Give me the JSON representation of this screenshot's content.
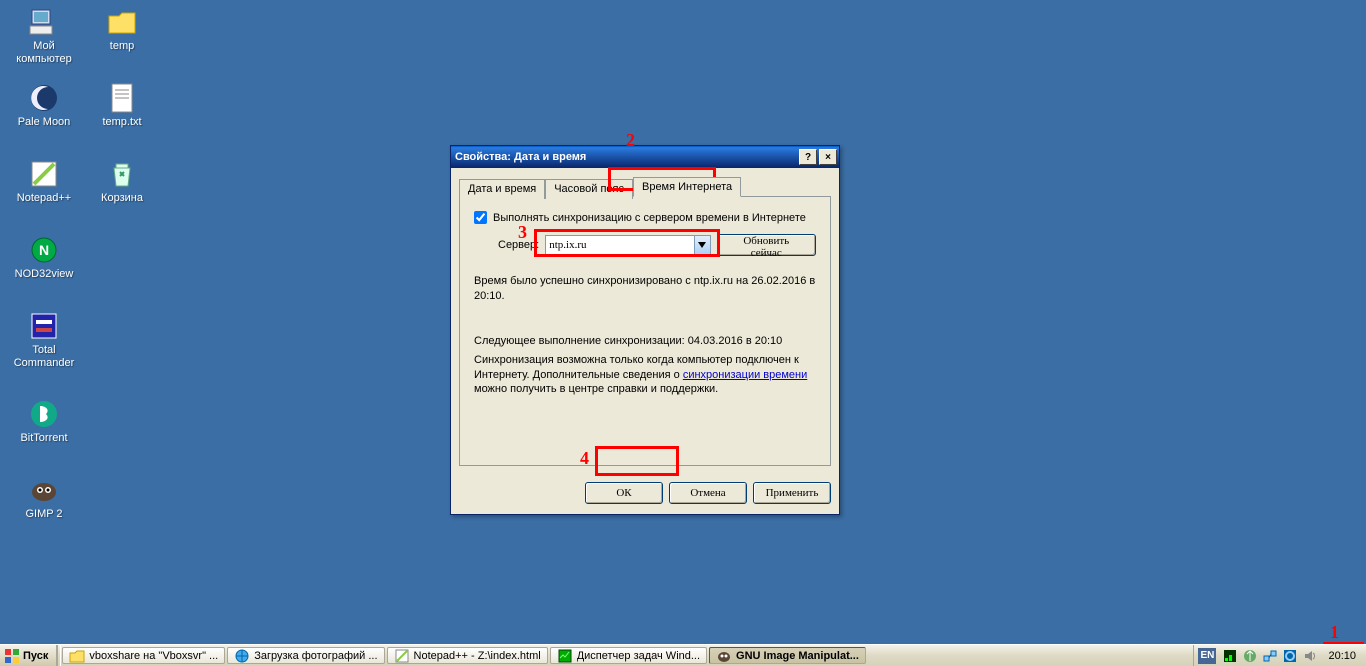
{
  "desktop_icons": [
    {
      "name": "my-computer",
      "label": "Мой\nкомпьютер"
    },
    {
      "name": "temp-folder",
      "label": "temp"
    },
    {
      "name": "pale-moon",
      "label": "Pale Moon"
    },
    {
      "name": "temp-txt",
      "label": "temp.txt"
    },
    {
      "name": "notepadpp",
      "label": "Notepad++"
    },
    {
      "name": "recycle-bin",
      "label": "Корзина"
    },
    {
      "name": "nod32view",
      "label": "NOD32view"
    },
    {
      "name": "total-commander",
      "label": "Total\nCommander"
    },
    {
      "name": "bittorrent",
      "label": "BitTorrent"
    },
    {
      "name": "gimp2",
      "label": "GIMP 2"
    }
  ],
  "dialog": {
    "title": "Свойства: Дата и время",
    "help_label": "?",
    "close_label": "×",
    "tabs": [
      {
        "label": "Дата и время"
      },
      {
        "label": "Часовой пояс"
      },
      {
        "label": "Время Интернета"
      }
    ],
    "active_tab": 2,
    "sync_checkbox_label": "Выполнять синхронизацию с сервером времени в Интернете",
    "sync_checked": true,
    "server_label": "Сервер:",
    "server_value": "ntp.ix.ru",
    "refresh_label": "Обновить сейчас",
    "status_text": "Время было успешно синхронизировано с ntp.ix.ru на 26.02.2016 в 20:10.",
    "next_text": "Следующее выполнение синхронизации: 04.03.2016 в 20:10",
    "note_prefix": "Синхронизация возможна только когда компьютер подключен к Интернету. Дополнительные сведения о ",
    "note_link": "синхронизации времени",
    "note_suffix": " можно получить в центре справки и поддержки.",
    "ok_label": "ОК",
    "cancel_label": "Отмена",
    "apply_label": "Применить"
  },
  "taskbar": {
    "start_label": "Пуск",
    "items": [
      {
        "label": "vboxshare на \"Vboxsvr\" ..."
      },
      {
        "label": "Загрузка фотографий ..."
      },
      {
        "label": "Notepad++ - Z:\\index.html"
      },
      {
        "label": "Диспетчер задач Wind..."
      },
      {
        "label": "GNU Image Manipulat..."
      }
    ],
    "active_item": 4,
    "lang": "EN",
    "clock": "20:10"
  },
  "annotations": {
    "n1": "1",
    "n2": "2",
    "n3": "3",
    "n4": "4"
  }
}
